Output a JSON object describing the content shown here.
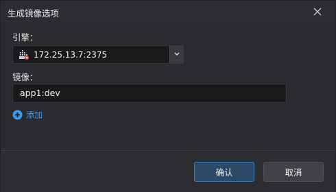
{
  "dialog": {
    "title": "生成镜像选项",
    "close_icon": "close-icon"
  },
  "engine": {
    "label": "引擎：",
    "value": "172.25.13.7:2375",
    "icon": "docker-engine-icon",
    "dropdown_icon": "chevron-down-icon"
  },
  "image": {
    "label": "镜像：",
    "value": "app1:dev"
  },
  "add": {
    "label": "添加",
    "icon": "plus-circle-icon",
    "color": "#3b9cf5"
  },
  "footer": {
    "ok_label": "确认",
    "cancel_label": "取消"
  }
}
